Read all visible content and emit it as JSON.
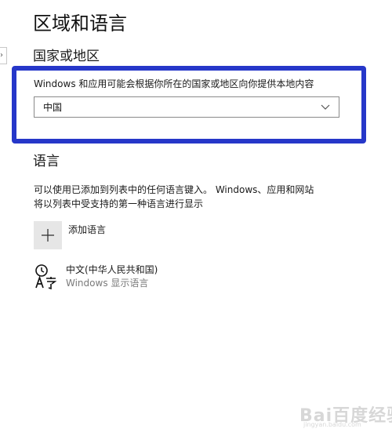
{
  "page": {
    "title": "区域和语言"
  },
  "region": {
    "heading": "国家或地区",
    "description": "Windows 和应用可能会根据你所在的国家或地区向你提供本地内容",
    "selected_country": "中国"
  },
  "language": {
    "heading": "语言",
    "description_line1": "可以使用已添加到列表中的任何语言键入。 Windows、应用和网站",
    "description_line2": "将以列表中受支持的第一种语言进行显示",
    "add_label": "添加语言",
    "items": [
      {
        "name": "中文(中华人民共和国)",
        "subtitle": "Windows 显示语言"
      }
    ]
  },
  "nav": {
    "edge_glyph": "›"
  },
  "watermark": {
    "brand": "Bai百度经验",
    "url": "jingyan.baidu.com"
  },
  "colors": {
    "highlight_border": "#2637c9",
    "add_button_bg": "#e6e6e6",
    "secondary_text": "#7a7a7a"
  },
  "icons": {
    "dropdown": "chevron-down-icon",
    "add": "plus-icon",
    "language": "language-icon"
  }
}
